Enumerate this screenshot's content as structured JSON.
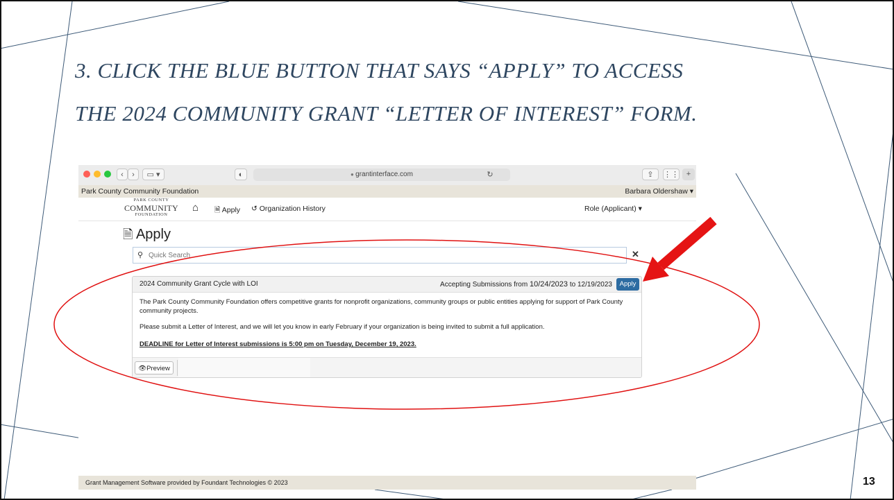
{
  "slide": {
    "title_line1": "3. CLICK THE BLUE BUTTON THAT SAYS “APPLY” TO ACCESS",
    "title_line2": "THE 2024 COMMUNITY GRANT “LETTER OF INTEREST” FORM.",
    "page_number": "13"
  },
  "browser": {
    "url": "grantinterface.com"
  },
  "app": {
    "org_name": "Park County Community Foundation",
    "user_name": "Barbara Oldershaw",
    "logo_top": "PARK COUNTY",
    "logo_main": "COMMUNITY",
    "logo_bottom": "FOUNDATION",
    "nav_apply": "Apply",
    "nav_history": "Organization History",
    "role": "Role (Applicant)",
    "page_heading": "Apply",
    "search_placeholder": "Quick Search"
  },
  "card": {
    "title": "2024 Community Grant Cycle with LOI",
    "accepting_prefix": "Accepting Submissions from",
    "date_from": "10/24/2023",
    "date_to_text": "to 12/19/2023",
    "apply_label": "Apply",
    "paragraph1": "The Park County Community Foundation offers competitive grants for nonprofit organizations, community groups or public entities applying for support of Park County community projects.",
    "paragraph2": "Please submit a Letter of Interest, and we will let you know in early February if your organization is being invited to submit a full application.",
    "deadline": "DEADLINE for Letter of Interest submissions is 5:00 pm on Tuesday, December 19, 2023.",
    "preview_label": "Preview"
  },
  "footer": {
    "text": "Grant Management Software provided by Foundant Technologies © 2023"
  },
  "colors": {
    "title": "#2e4660",
    "apply_button": "#2d6ca2",
    "annotation": "#e01010"
  },
  "icons": [
    "search-icon",
    "close-icon",
    "home-icon",
    "document-icon",
    "history-icon",
    "eye-icon",
    "lock-icon",
    "reload-icon",
    "share-icon",
    "caret-down-icon",
    "arrow-annotation"
  ]
}
